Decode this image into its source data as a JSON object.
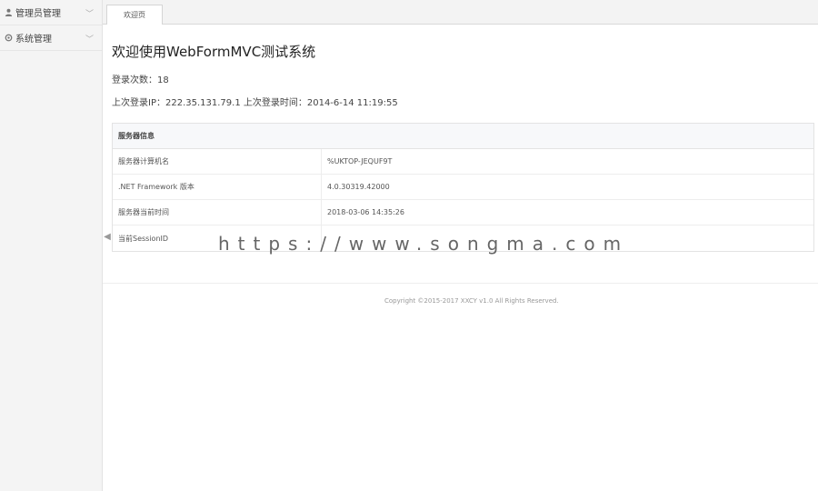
{
  "sidebar": {
    "items": [
      {
        "label": "管理员管理",
        "icon": "user-icon"
      },
      {
        "label": "系统管理",
        "icon": "gear-icon"
      }
    ]
  },
  "tabs": [
    {
      "label": "欢迎页"
    }
  ],
  "main": {
    "title": "欢迎使用WebFormMVC测试系统",
    "login_count": "登录次数：18",
    "last_login": "上次登录IP：222.35.131.79.1 上次登录时间：2014-6-14 11:19:55"
  },
  "server": {
    "header": "服务器信息",
    "rows": [
      {
        "key": "服务器计算机名",
        "value": "%UKTOP-JEQUF9T"
      },
      {
        "key": ".NET Framework 版本",
        "value": "4.0.30319.42000"
      },
      {
        "key": "服务器当前时间",
        "value": "2018-03-06 14:35:26"
      },
      {
        "key": "当前SessionID",
        "value": ""
      }
    ]
  },
  "watermark": "https://www.songma.com",
  "footer": {
    "copyright": "Copyright ©2015-2017 XXCY v1.0 All Rights Reserved."
  }
}
